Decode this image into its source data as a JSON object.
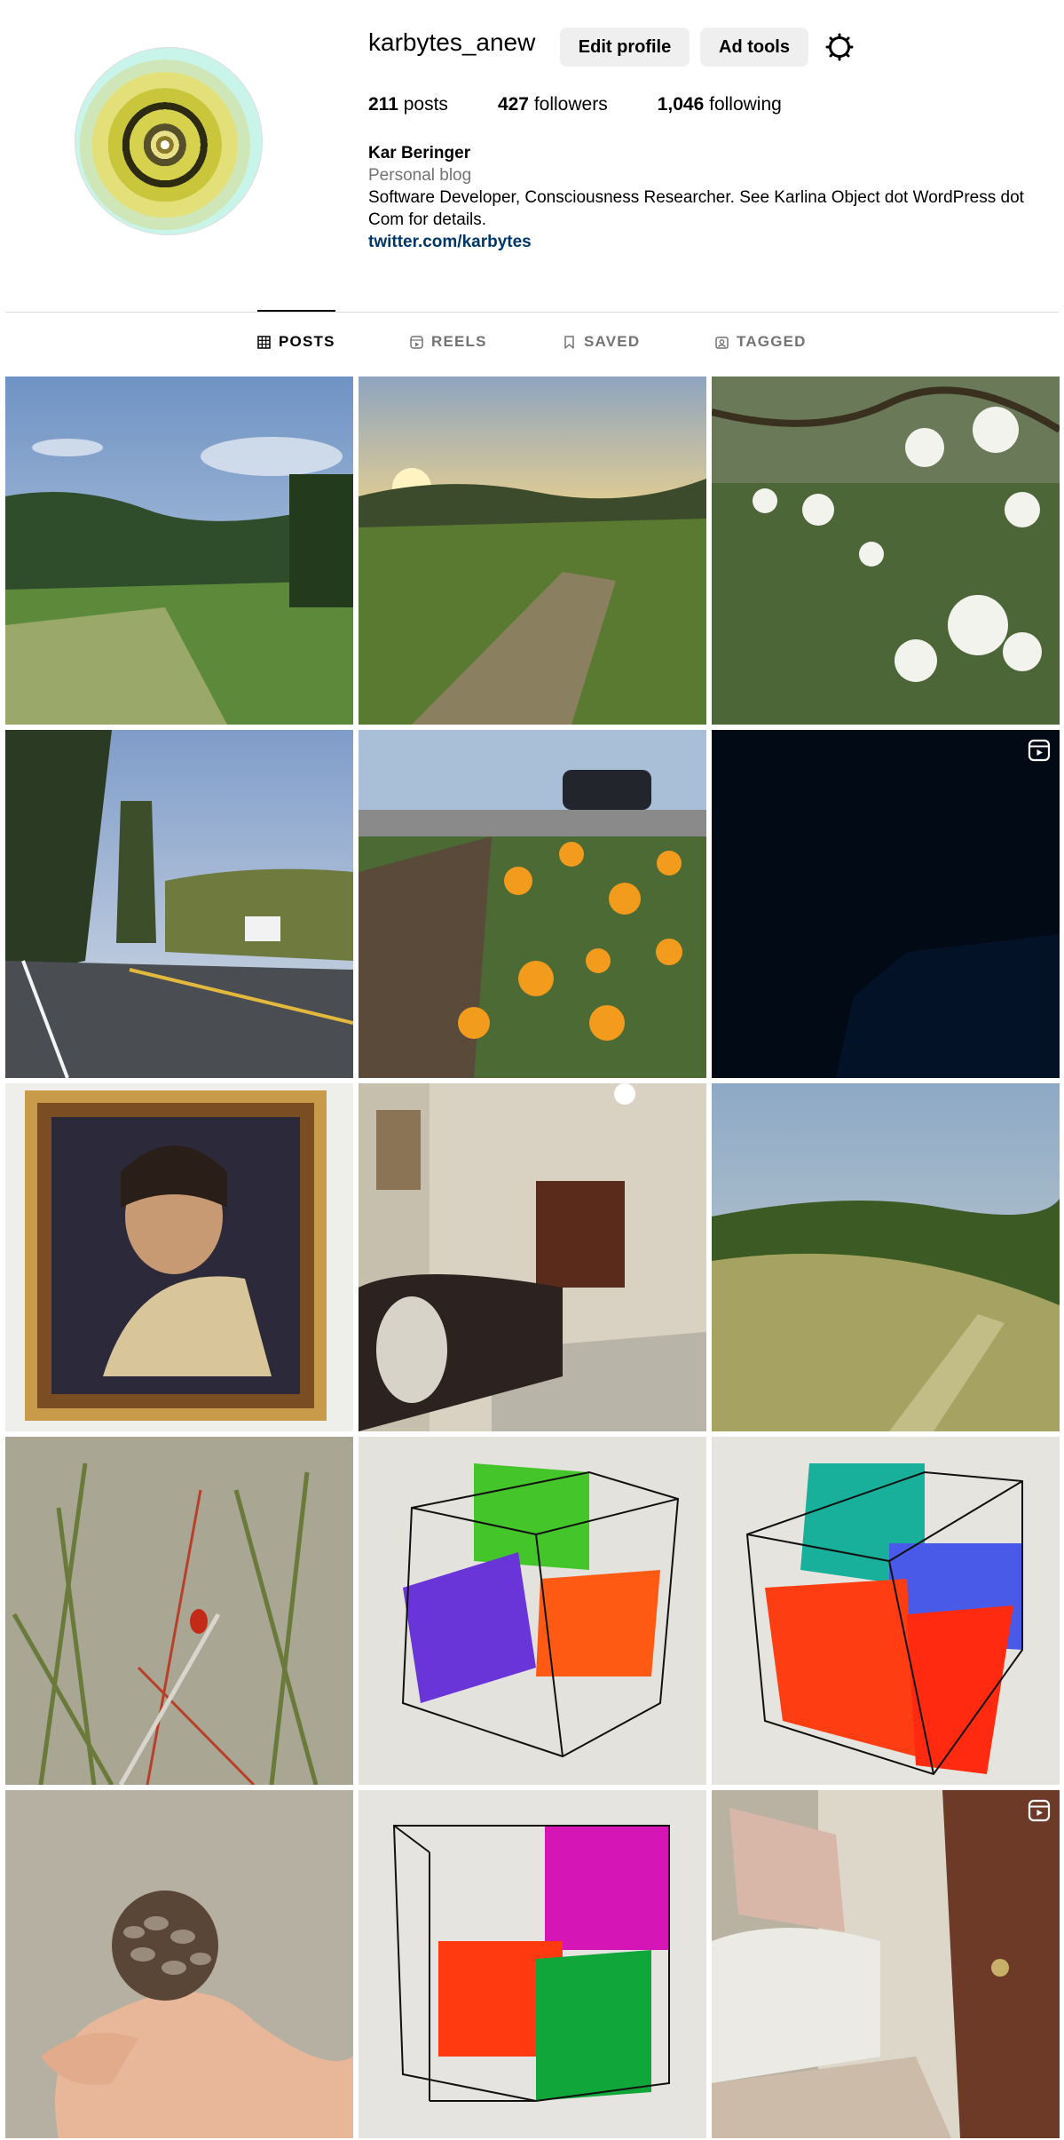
{
  "profile": {
    "username": "karbytes_anew",
    "edit_label": "Edit profile",
    "ad_tools_label": "Ad tools",
    "stats": {
      "posts_count": "211",
      "posts_label": "posts",
      "followers_count": "427",
      "followers_label": "followers",
      "following_count": "1,046",
      "following_label": "following"
    },
    "bio": {
      "name": "Kar Beringer",
      "category": "Personal blog",
      "text": "Software Developer, Consciousness Researcher. See Karlina Object dot WordPress dot Com for details.",
      "link": "twitter.com/karbytes"
    }
  },
  "tabs": [
    {
      "label": "POSTS",
      "icon": "grid-icon",
      "active": true
    },
    {
      "label": "REELS",
      "icon": "reels-icon",
      "active": false
    },
    {
      "label": "SAVED",
      "icon": "bookmark-icon",
      "active": false
    },
    {
      "label": "TAGGED",
      "icon": "tag-icon",
      "active": false
    }
  ],
  "posts": [
    {
      "subject": "field-under-sky",
      "reel": false
    },
    {
      "subject": "sunset-meadow",
      "reel": false
    },
    {
      "subject": "white-wildflowers",
      "reel": false
    },
    {
      "subject": "suburban-road",
      "reel": false
    },
    {
      "subject": "orange-poppies",
      "reel": true
    },
    {
      "subject": "dark-reel",
      "reel": true
    },
    {
      "subject": "framed-portrait-painting",
      "reel": false
    },
    {
      "subject": "living-room",
      "reel": false
    },
    {
      "subject": "grassy-hillside",
      "reel": false
    },
    {
      "subject": "ladybug-on-grass",
      "reel": false
    },
    {
      "subject": "cube-drawing-green-purple-orange",
      "reel": false
    },
    {
      "subject": "cube-drawing-teal-blue-red",
      "reel": false
    },
    {
      "subject": "pinecone-in-hand",
      "reel": false
    },
    {
      "subject": "cube-drawing-magenta-red-green",
      "reel": false
    },
    {
      "subject": "bedroom-door-reel",
      "reel": true
    }
  ],
  "colors": {
    "link": "#00376b",
    "muted": "#737373",
    "button_bg": "#efefef"
  }
}
